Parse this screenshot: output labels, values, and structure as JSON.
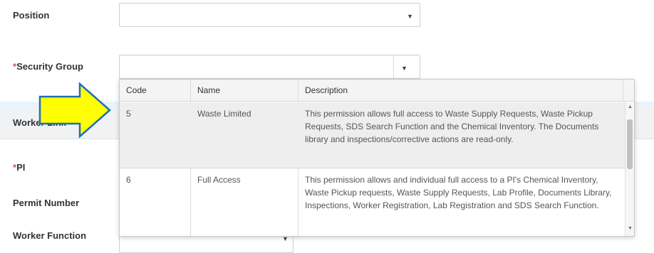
{
  "form": {
    "position_label": "Position",
    "security_group_required": "*",
    "security_group_label": "Security Group",
    "worker_link_label": "Worker Link",
    "pi_required": "*",
    "pi_label": "PI",
    "permit_number_label": "Permit Number",
    "worker_function_label": "Worker Function"
  },
  "dropdown": {
    "columns": [
      "Code",
      "Name",
      "Description"
    ],
    "rows": [
      {
        "code": "5",
        "name": "Waste Limited",
        "description": "This permission allows full access to Waste Supply Requests, Waste Pickup Requests, SDS Search Function and the Chemical Inventory. The Documents library and inspections/corrective actions are read-only."
      },
      {
        "code": "6",
        "name": "Full Access",
        "description": "This permission allows and individual full access to a PI's Chemical Inventory, Waste Pickup requests, Waste Supply Requests, Lab Profile, Documents Library, Inspections, Worker Registration, Lab Registration and SDS Search Function."
      }
    ]
  },
  "icons": {
    "caret": "▼",
    "scroll_up": "▲",
    "scroll_down": "▼"
  },
  "colors": {
    "required": "#d9534f",
    "arrow_fill": "#ffff00",
    "arrow_stroke": "#1f6fb5"
  }
}
